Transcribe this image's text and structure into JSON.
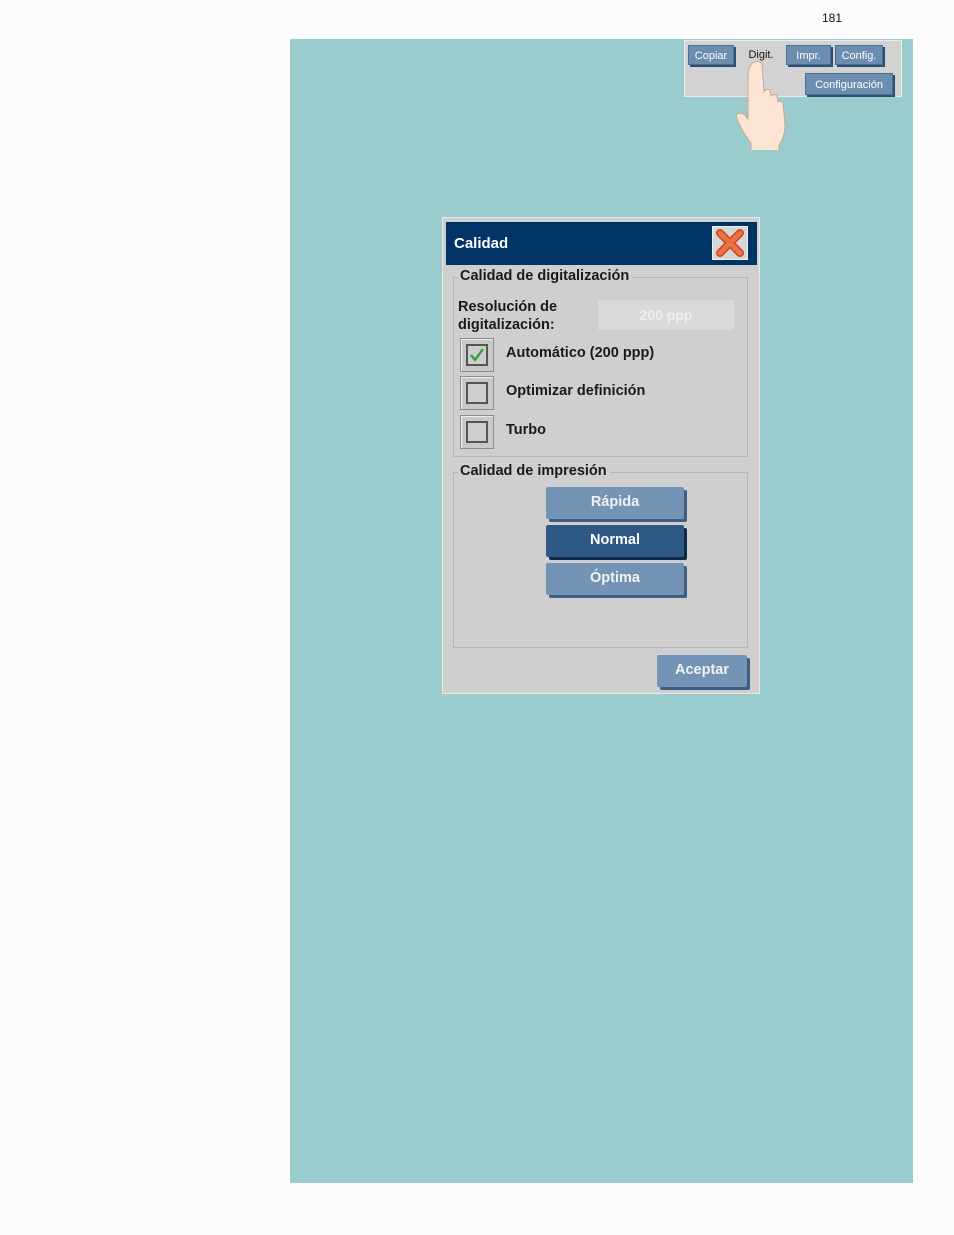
{
  "page": {
    "number": "181"
  },
  "mini_nav": {
    "tabs": [
      {
        "label": "Copiar",
        "active": false
      },
      {
        "label": "Digit.",
        "active": true
      },
      {
        "label": "Impr.",
        "active": false
      },
      {
        "label": "Config.",
        "active": false
      }
    ],
    "config_button": "Configuración",
    "pointer": "hand-pointer-icon"
  },
  "dialog": {
    "title": "Calidad",
    "close_icon": "close-x-icon",
    "scan_quality": {
      "legend": "Calidad de digitalización",
      "resolution_label_line1": "Resolución de",
      "resolution_label_line2": "digitalización:",
      "resolution_value": "200 ppp",
      "options": [
        {
          "label": "Automático (200 ppp)",
          "checked": true
        },
        {
          "label": "Optimizar definición",
          "checked": false
        },
        {
          "label": "Turbo",
          "checked": false
        }
      ]
    },
    "print_quality": {
      "legend": "Calidad de impresión",
      "buttons": [
        {
          "label": "Rápida",
          "selected": false
        },
        {
          "label": "Normal",
          "selected": true
        },
        {
          "label": "Óptima",
          "selected": false
        }
      ]
    },
    "accept_label": "Aceptar"
  },
  "colors": {
    "background_panel": "#9bcccd",
    "title_bar": "#003366",
    "button": "#7394b4",
    "button_selected": "#2f5985",
    "check": "#3aa03a",
    "close": "#e8623a"
  }
}
